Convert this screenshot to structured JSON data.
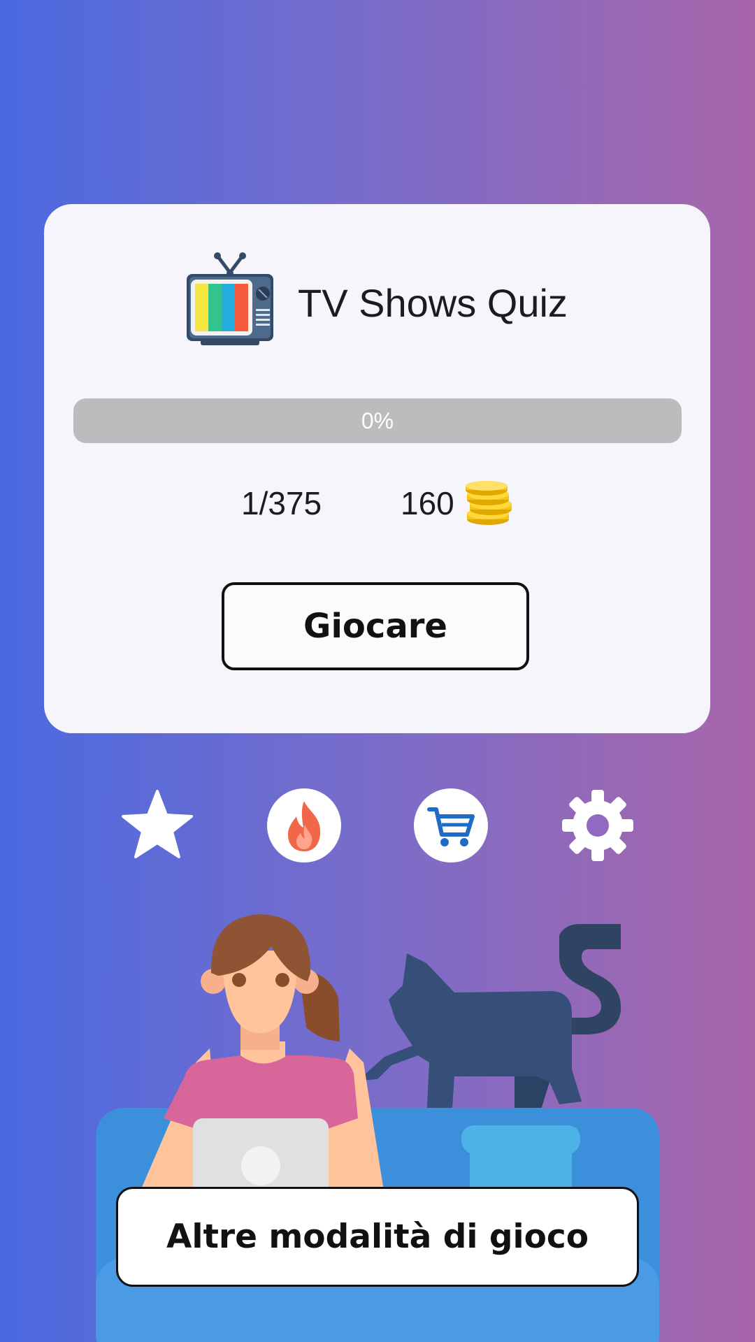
{
  "app": {
    "title": "TV Shows Quiz",
    "logo_icon": "retro-tv-icon"
  },
  "progress": {
    "value": 0,
    "label": "0%",
    "fill_color": "#8a7fd6",
    "track_color": "#bcbcbf"
  },
  "stats": {
    "level": "1/375",
    "coins": "160",
    "coins_icon": "gold-coins-icon"
  },
  "buttons": {
    "play_label": "Giocare",
    "modes_label": "Altre modalità di gioco"
  },
  "toolbar": [
    {
      "name": "favorites",
      "icon": "star-icon"
    },
    {
      "name": "streak",
      "icon": "fire-icon"
    },
    {
      "name": "shop",
      "icon": "cart-icon"
    },
    {
      "name": "settings",
      "icon": "gear-icon"
    }
  ],
  "theme": {
    "background_left": "#4a6ae0",
    "background_right": "#a866aa",
    "card_background": "#f6f5fb"
  }
}
